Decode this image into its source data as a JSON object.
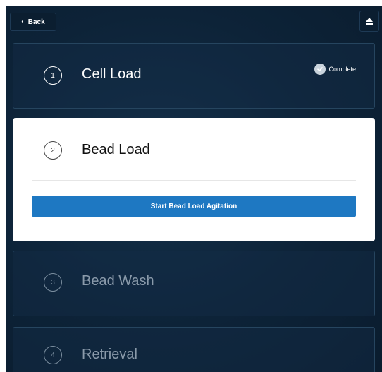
{
  "header": {
    "back_label": "Back",
    "back_icon": "chevron-left-icon",
    "eject_icon": "eject-icon"
  },
  "steps": [
    {
      "number": "1",
      "title": "Cell Load",
      "state": "complete",
      "badge": "Complete"
    },
    {
      "number": "2",
      "title": "Bead Load",
      "state": "active",
      "action_label": "Start Bead Load Agitation"
    },
    {
      "number": "3",
      "title": "Bead Wash",
      "state": "pending"
    },
    {
      "number": "4",
      "title": "Retrieval",
      "state": "pending"
    }
  ],
  "colors": {
    "background": "#0d2338",
    "accent": "#1e78c2",
    "active_card": "#ffffff",
    "pending_text": "#8a9aaa"
  }
}
